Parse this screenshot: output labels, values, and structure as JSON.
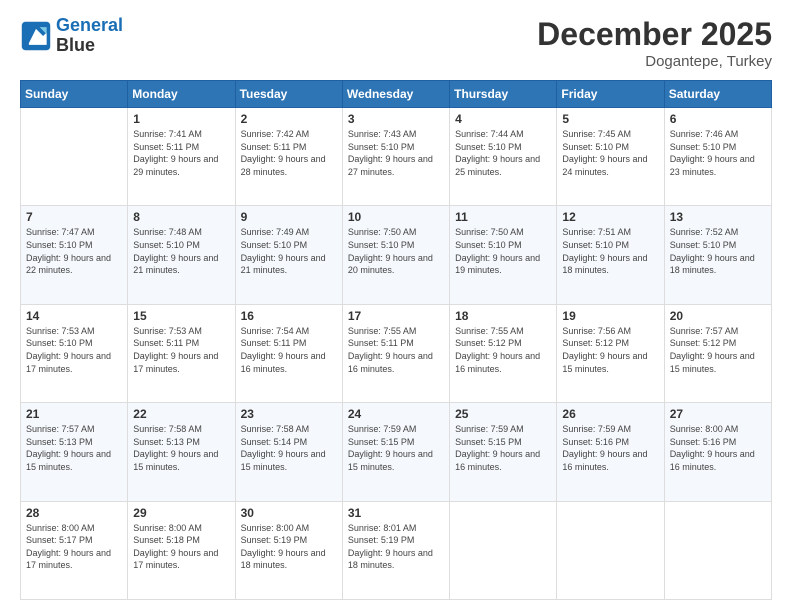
{
  "header": {
    "logo_line1": "General",
    "logo_line2": "Blue",
    "month_title": "December 2025",
    "location": "Dogantepe, Turkey"
  },
  "weekdays": [
    "Sunday",
    "Monday",
    "Tuesday",
    "Wednesday",
    "Thursday",
    "Friday",
    "Saturday"
  ],
  "weeks": [
    [
      {
        "day": "",
        "sunrise": "",
        "sunset": "",
        "daylight": ""
      },
      {
        "day": "1",
        "sunrise": "Sunrise: 7:41 AM",
        "sunset": "Sunset: 5:11 PM",
        "daylight": "Daylight: 9 hours and 29 minutes."
      },
      {
        "day": "2",
        "sunrise": "Sunrise: 7:42 AM",
        "sunset": "Sunset: 5:11 PM",
        "daylight": "Daylight: 9 hours and 28 minutes."
      },
      {
        "day": "3",
        "sunrise": "Sunrise: 7:43 AM",
        "sunset": "Sunset: 5:10 PM",
        "daylight": "Daylight: 9 hours and 27 minutes."
      },
      {
        "day": "4",
        "sunrise": "Sunrise: 7:44 AM",
        "sunset": "Sunset: 5:10 PM",
        "daylight": "Daylight: 9 hours and 25 minutes."
      },
      {
        "day": "5",
        "sunrise": "Sunrise: 7:45 AM",
        "sunset": "Sunset: 5:10 PM",
        "daylight": "Daylight: 9 hours and 24 minutes."
      },
      {
        "day": "6",
        "sunrise": "Sunrise: 7:46 AM",
        "sunset": "Sunset: 5:10 PM",
        "daylight": "Daylight: 9 hours and 23 minutes."
      }
    ],
    [
      {
        "day": "7",
        "sunrise": "Sunrise: 7:47 AM",
        "sunset": "Sunset: 5:10 PM",
        "daylight": "Daylight: 9 hours and 22 minutes."
      },
      {
        "day": "8",
        "sunrise": "Sunrise: 7:48 AM",
        "sunset": "Sunset: 5:10 PM",
        "daylight": "Daylight: 9 hours and 21 minutes."
      },
      {
        "day": "9",
        "sunrise": "Sunrise: 7:49 AM",
        "sunset": "Sunset: 5:10 PM",
        "daylight": "Daylight: 9 hours and 21 minutes."
      },
      {
        "day": "10",
        "sunrise": "Sunrise: 7:50 AM",
        "sunset": "Sunset: 5:10 PM",
        "daylight": "Daylight: 9 hours and 20 minutes."
      },
      {
        "day": "11",
        "sunrise": "Sunrise: 7:50 AM",
        "sunset": "Sunset: 5:10 PM",
        "daylight": "Daylight: 9 hours and 19 minutes."
      },
      {
        "day": "12",
        "sunrise": "Sunrise: 7:51 AM",
        "sunset": "Sunset: 5:10 PM",
        "daylight": "Daylight: 9 hours and 18 minutes."
      },
      {
        "day": "13",
        "sunrise": "Sunrise: 7:52 AM",
        "sunset": "Sunset: 5:10 PM",
        "daylight": "Daylight: 9 hours and 18 minutes."
      }
    ],
    [
      {
        "day": "14",
        "sunrise": "Sunrise: 7:53 AM",
        "sunset": "Sunset: 5:10 PM",
        "daylight": "Daylight: 9 hours and 17 minutes."
      },
      {
        "day": "15",
        "sunrise": "Sunrise: 7:53 AM",
        "sunset": "Sunset: 5:11 PM",
        "daylight": "Daylight: 9 hours and 17 minutes."
      },
      {
        "day": "16",
        "sunrise": "Sunrise: 7:54 AM",
        "sunset": "Sunset: 5:11 PM",
        "daylight": "Daylight: 9 hours and 16 minutes."
      },
      {
        "day": "17",
        "sunrise": "Sunrise: 7:55 AM",
        "sunset": "Sunset: 5:11 PM",
        "daylight": "Daylight: 9 hours and 16 minutes."
      },
      {
        "day": "18",
        "sunrise": "Sunrise: 7:55 AM",
        "sunset": "Sunset: 5:12 PM",
        "daylight": "Daylight: 9 hours and 16 minutes."
      },
      {
        "day": "19",
        "sunrise": "Sunrise: 7:56 AM",
        "sunset": "Sunset: 5:12 PM",
        "daylight": "Daylight: 9 hours and 15 minutes."
      },
      {
        "day": "20",
        "sunrise": "Sunrise: 7:57 AM",
        "sunset": "Sunset: 5:12 PM",
        "daylight": "Daylight: 9 hours and 15 minutes."
      }
    ],
    [
      {
        "day": "21",
        "sunrise": "Sunrise: 7:57 AM",
        "sunset": "Sunset: 5:13 PM",
        "daylight": "Daylight: 9 hours and 15 minutes."
      },
      {
        "day": "22",
        "sunrise": "Sunrise: 7:58 AM",
        "sunset": "Sunset: 5:13 PM",
        "daylight": "Daylight: 9 hours and 15 minutes."
      },
      {
        "day": "23",
        "sunrise": "Sunrise: 7:58 AM",
        "sunset": "Sunset: 5:14 PM",
        "daylight": "Daylight: 9 hours and 15 minutes."
      },
      {
        "day": "24",
        "sunrise": "Sunrise: 7:59 AM",
        "sunset": "Sunset: 5:15 PM",
        "daylight": "Daylight: 9 hours and 15 minutes."
      },
      {
        "day": "25",
        "sunrise": "Sunrise: 7:59 AM",
        "sunset": "Sunset: 5:15 PM",
        "daylight": "Daylight: 9 hours and 16 minutes."
      },
      {
        "day": "26",
        "sunrise": "Sunrise: 7:59 AM",
        "sunset": "Sunset: 5:16 PM",
        "daylight": "Daylight: 9 hours and 16 minutes."
      },
      {
        "day": "27",
        "sunrise": "Sunrise: 8:00 AM",
        "sunset": "Sunset: 5:16 PM",
        "daylight": "Daylight: 9 hours and 16 minutes."
      }
    ],
    [
      {
        "day": "28",
        "sunrise": "Sunrise: 8:00 AM",
        "sunset": "Sunset: 5:17 PM",
        "daylight": "Daylight: 9 hours and 17 minutes."
      },
      {
        "day": "29",
        "sunrise": "Sunrise: 8:00 AM",
        "sunset": "Sunset: 5:18 PM",
        "daylight": "Daylight: 9 hours and 17 minutes."
      },
      {
        "day": "30",
        "sunrise": "Sunrise: 8:00 AM",
        "sunset": "Sunset: 5:19 PM",
        "daylight": "Daylight: 9 hours and 18 minutes."
      },
      {
        "day": "31",
        "sunrise": "Sunrise: 8:01 AM",
        "sunset": "Sunset: 5:19 PM",
        "daylight": "Daylight: 9 hours and 18 minutes."
      },
      {
        "day": "",
        "sunrise": "",
        "sunset": "",
        "daylight": ""
      },
      {
        "day": "",
        "sunrise": "",
        "sunset": "",
        "daylight": ""
      },
      {
        "day": "",
        "sunrise": "",
        "sunset": "",
        "daylight": ""
      }
    ]
  ]
}
